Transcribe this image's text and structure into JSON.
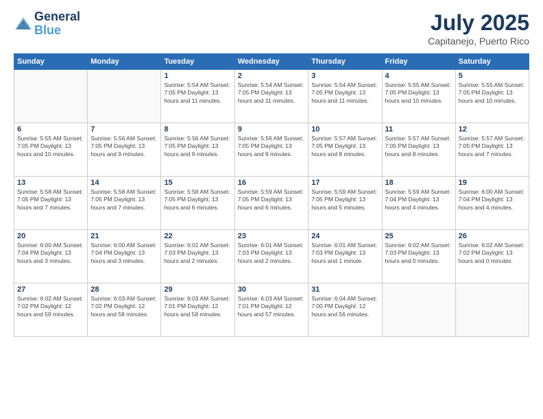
{
  "header": {
    "logo_line1": "General",
    "logo_line2": "Blue",
    "month_year": "July 2025",
    "location": "Capitanejo, Puerto Rico"
  },
  "weekdays": [
    "Sunday",
    "Monday",
    "Tuesday",
    "Wednesday",
    "Thursday",
    "Friday",
    "Saturday"
  ],
  "weeks": [
    [
      {
        "day": "",
        "detail": ""
      },
      {
        "day": "",
        "detail": ""
      },
      {
        "day": "1",
        "detail": "Sunrise: 5:54 AM\nSunset: 7:05 PM\nDaylight: 13 hours and 11 minutes."
      },
      {
        "day": "2",
        "detail": "Sunrise: 5:54 AM\nSunset: 7:05 PM\nDaylight: 13 hours and 11 minutes."
      },
      {
        "day": "3",
        "detail": "Sunrise: 5:54 AM\nSunset: 7:05 PM\nDaylight: 13 hours and 11 minutes."
      },
      {
        "day": "4",
        "detail": "Sunrise: 5:55 AM\nSunset: 7:05 PM\nDaylight: 13 hours and 10 minutes."
      },
      {
        "day": "5",
        "detail": "Sunrise: 5:55 AM\nSunset: 7:05 PM\nDaylight: 13 hours and 10 minutes."
      }
    ],
    [
      {
        "day": "6",
        "detail": "Sunrise: 5:55 AM\nSunset: 7:05 PM\nDaylight: 13 hours and 10 minutes."
      },
      {
        "day": "7",
        "detail": "Sunrise: 5:56 AM\nSunset: 7:05 PM\nDaylight: 13 hours and 9 minutes."
      },
      {
        "day": "8",
        "detail": "Sunrise: 5:56 AM\nSunset: 7:05 PM\nDaylight: 13 hours and 9 minutes."
      },
      {
        "day": "9",
        "detail": "Sunrise: 5:56 AM\nSunset: 7:05 PM\nDaylight: 13 hours and 9 minutes."
      },
      {
        "day": "10",
        "detail": "Sunrise: 5:57 AM\nSunset: 7:05 PM\nDaylight: 13 hours and 8 minutes."
      },
      {
        "day": "11",
        "detail": "Sunrise: 5:57 AM\nSunset: 7:05 PM\nDaylight: 13 hours and 8 minutes."
      },
      {
        "day": "12",
        "detail": "Sunrise: 5:57 AM\nSunset: 7:05 PM\nDaylight: 13 hours and 7 minutes."
      }
    ],
    [
      {
        "day": "13",
        "detail": "Sunrise: 5:58 AM\nSunset: 7:05 PM\nDaylight: 13 hours and 7 minutes."
      },
      {
        "day": "14",
        "detail": "Sunrise: 5:58 AM\nSunset: 7:05 PM\nDaylight: 13 hours and 7 minutes."
      },
      {
        "day": "15",
        "detail": "Sunrise: 5:58 AM\nSunset: 7:05 PM\nDaylight: 13 hours and 6 minutes."
      },
      {
        "day": "16",
        "detail": "Sunrise: 5:59 AM\nSunset: 7:05 PM\nDaylight: 13 hours and 6 minutes."
      },
      {
        "day": "17",
        "detail": "Sunrise: 5:59 AM\nSunset: 7:05 PM\nDaylight: 13 hours and 5 minutes."
      },
      {
        "day": "18",
        "detail": "Sunrise: 5:59 AM\nSunset: 7:04 PM\nDaylight: 13 hours and 4 minutes."
      },
      {
        "day": "19",
        "detail": "Sunrise: 6:00 AM\nSunset: 7:04 PM\nDaylight: 13 hours and 4 minutes."
      }
    ],
    [
      {
        "day": "20",
        "detail": "Sunrise: 6:00 AM\nSunset: 7:04 PM\nDaylight: 13 hours and 3 minutes."
      },
      {
        "day": "21",
        "detail": "Sunrise: 6:00 AM\nSunset: 7:04 PM\nDaylight: 13 hours and 3 minutes."
      },
      {
        "day": "22",
        "detail": "Sunrise: 6:01 AM\nSunset: 7:03 PM\nDaylight: 13 hours and 2 minutes."
      },
      {
        "day": "23",
        "detail": "Sunrise: 6:01 AM\nSunset: 7:03 PM\nDaylight: 13 hours and 2 minutes."
      },
      {
        "day": "24",
        "detail": "Sunrise: 6:01 AM\nSunset: 7:03 PM\nDaylight: 13 hours and 1 minute."
      },
      {
        "day": "25",
        "detail": "Sunrise: 6:02 AM\nSunset: 7:03 PM\nDaylight: 13 hours and 0 minutes."
      },
      {
        "day": "26",
        "detail": "Sunrise: 6:02 AM\nSunset: 7:02 PM\nDaylight: 13 hours and 0 minutes."
      }
    ],
    [
      {
        "day": "27",
        "detail": "Sunrise: 6:02 AM\nSunset: 7:02 PM\nDaylight: 12 hours and 59 minutes."
      },
      {
        "day": "28",
        "detail": "Sunrise: 6:03 AM\nSunset: 7:02 PM\nDaylight: 12 hours and 58 minutes."
      },
      {
        "day": "29",
        "detail": "Sunrise: 6:03 AM\nSunset: 7:01 PM\nDaylight: 12 hours and 58 minutes."
      },
      {
        "day": "30",
        "detail": "Sunrise: 6:03 AM\nSunset: 7:01 PM\nDaylight: 12 hours and 57 minutes."
      },
      {
        "day": "31",
        "detail": "Sunrise: 6:04 AM\nSunset: 7:00 PM\nDaylight: 12 hours and 56 minutes."
      },
      {
        "day": "",
        "detail": ""
      },
      {
        "day": "",
        "detail": ""
      }
    ]
  ]
}
